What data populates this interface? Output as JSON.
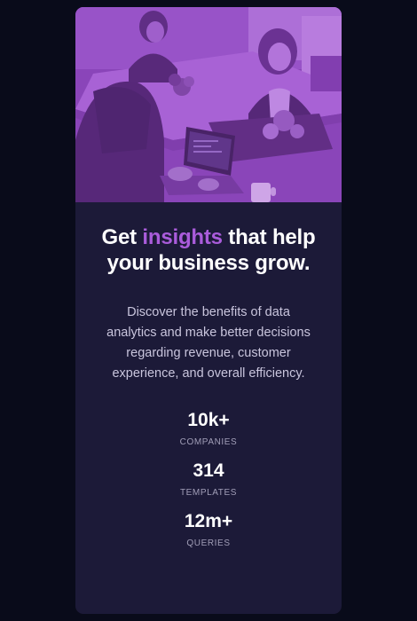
{
  "hero_image": {
    "icon": "office-team-photo-icon",
    "tint_color": "#aa5cdb"
  },
  "headline": {
    "before": "Get ",
    "accent": "insights",
    "after": " that help your business grow."
  },
  "description": "Discover the benefits of data analytics and make better decisions regarding revenue, customer experience, and overall efficiency.",
  "stats": [
    {
      "value": "10k+",
      "label": "COMPANIES"
    },
    {
      "value": "314",
      "label": "TEMPLATES"
    },
    {
      "value": "12m+",
      "label": "QUERIES"
    }
  ],
  "colors": {
    "page_background": "#090b1a",
    "card_background": "#1c1a38",
    "accent": "#aa5cdb",
    "text_primary": "#ffffff",
    "text_secondary": "#c9c5dd",
    "text_muted": "#a29fb8"
  }
}
